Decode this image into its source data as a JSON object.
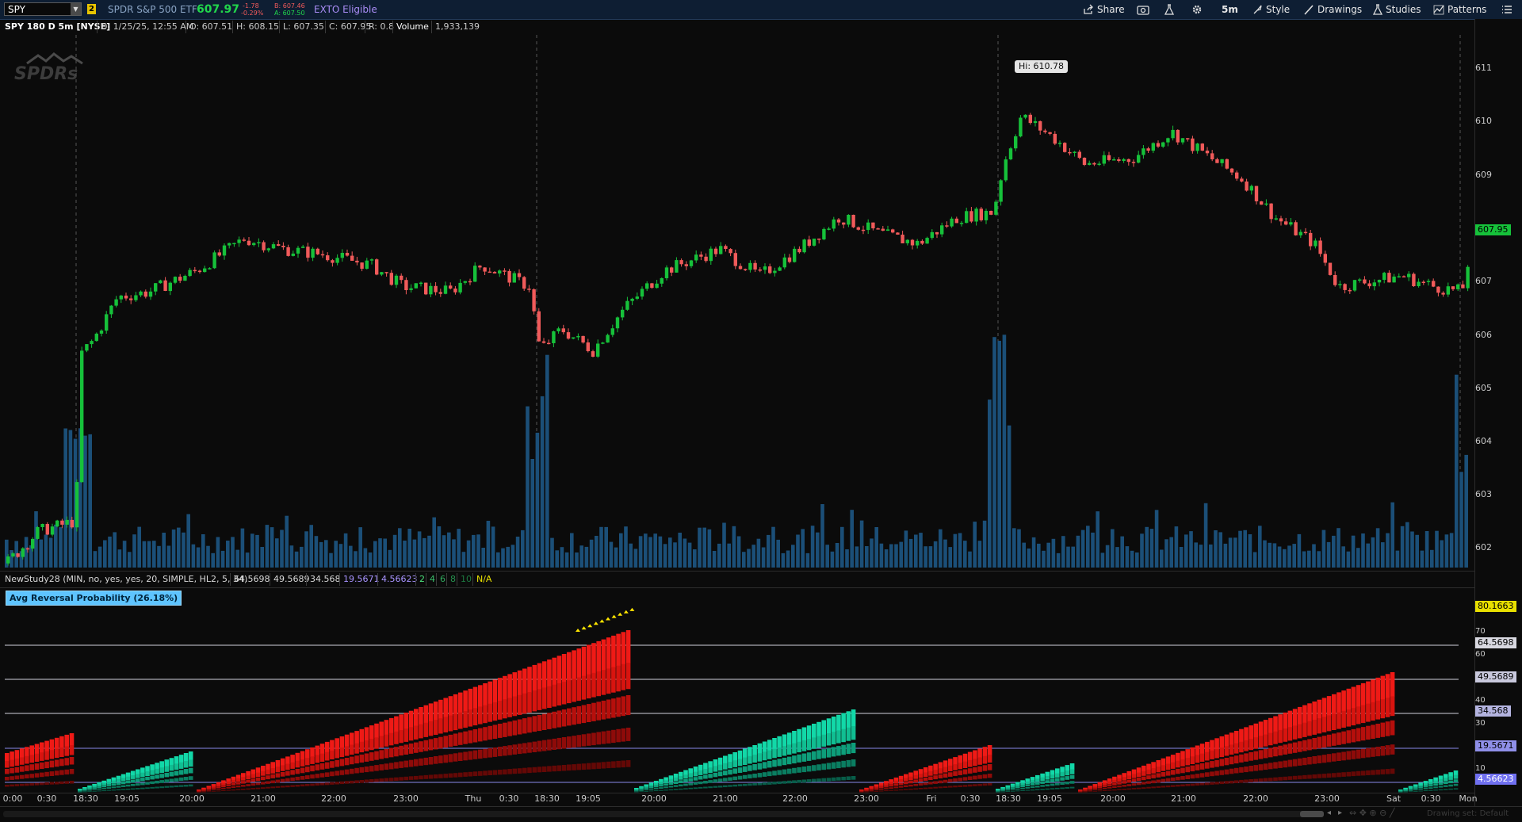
{
  "toolbar": {
    "symbol": "SPY",
    "link_badge": "2",
    "description": "SPDR S&P 500 ETF",
    "last_price": "607.97",
    "change": "-1.78",
    "change_pct": "-0.29%",
    "bid": "B: 607.46",
    "ask": "A: 607.50",
    "exto": "EXTO Eligible",
    "share": "Share",
    "timeframe": "5m",
    "style": "Style",
    "drawings": "Drawings",
    "studies": "Studies",
    "patterns": "Patterns"
  },
  "chart_info": {
    "title": "SPY 180 D 5m [NYSE]",
    "date": "D: 1/25/25, 12:55 AM",
    "open": "O: 607.51",
    "high": "H: 608.15",
    "low": "L: 607.35",
    "close": "C: 607.95",
    "range": "R: 0.8",
    "volume_label": "Volume",
    "volume_value": "1,933,139"
  },
  "logo_text": "SPDRs",
  "hi_bubble": "Hi: 610.78",
  "price_axis": {
    "ticks": [
      "611",
      "610",
      "609",
      "608",
      "607",
      "606",
      "605",
      "604",
      "603",
      "602"
    ],
    "current": "607.95",
    "current_color": "#16c13a"
  },
  "study_header": {
    "name": "NewStudy28 (MIN, no, yes, yes, 20, SIMPLE, HL2, 5, 34)",
    "v1": "64.5698",
    "v2": "49.5689",
    "v3": "34.568",
    "v4": "19.5671",
    "v5": "4.56623",
    "c2": "2",
    "c4": "4",
    "c6": "6",
    "c8": "8",
    "c10": "10",
    "na": "N/A"
  },
  "study_label": "Avg Reversal Probability (26.18%)",
  "study_axis": {
    "ticks": [
      "70",
      "60",
      "50",
      "40",
      "30",
      "10"
    ],
    "top_value": "80.1663",
    "levels": [
      "64.5698",
      "49.5689",
      "34.568",
      "19.5671",
      "4.56623"
    ]
  },
  "time_axis": [
    "0:00",
    "0:30",
    "18:30",
    "19:05",
    "20:00",
    "21:00",
    "22:00",
    "23:00",
    "Thu",
    "0:30",
    "18:30",
    "19:05",
    "20:00",
    "21:00",
    "22:00",
    "23:00",
    "Fri",
    "0:30",
    "18:30",
    "19:05",
    "20:00",
    "21:00",
    "22:00",
    "23:00",
    "Sat",
    "0:30",
    "Mon"
  ],
  "scrollbar_hint": "Drawing set: Default",
  "colors": {
    "up": "#16c13a",
    "down": "#f05a5a",
    "volume": "#1b4f78",
    "hist_red": "#e01010",
    "hist_green": "#10c89a"
  }
}
